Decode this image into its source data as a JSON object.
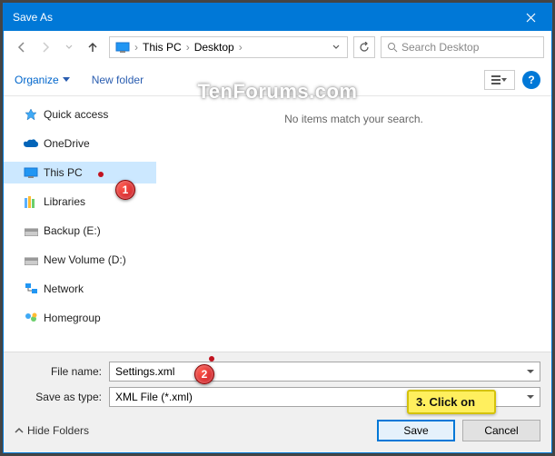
{
  "window": {
    "title": "Save As"
  },
  "nav": {
    "crumb1": "This PC",
    "crumb2": "Desktop",
    "search_placeholder": "Search Desktop"
  },
  "toolbar": {
    "organize": "Organize",
    "newfolder": "New folder"
  },
  "sidebar": {
    "items": [
      {
        "label": "Quick access"
      },
      {
        "label": "OneDrive"
      },
      {
        "label": "This PC"
      },
      {
        "label": "Libraries"
      },
      {
        "label": "Backup (E:)"
      },
      {
        "label": "New Volume (D:)"
      },
      {
        "label": "Network"
      },
      {
        "label": "Homegroup"
      }
    ]
  },
  "content": {
    "empty": "No items match your search."
  },
  "watermark": "TenForums.com",
  "footer": {
    "filename_label": "File name:",
    "filename_value": "Settings.xml",
    "type_label": "Save as type:",
    "type_value": "XML File (*.xml)",
    "hide": "Hide Folders",
    "save": "Save",
    "cancel": "Cancel"
  },
  "annotations": {
    "n1": "1",
    "n2": "2",
    "n3": "3. Click on"
  }
}
